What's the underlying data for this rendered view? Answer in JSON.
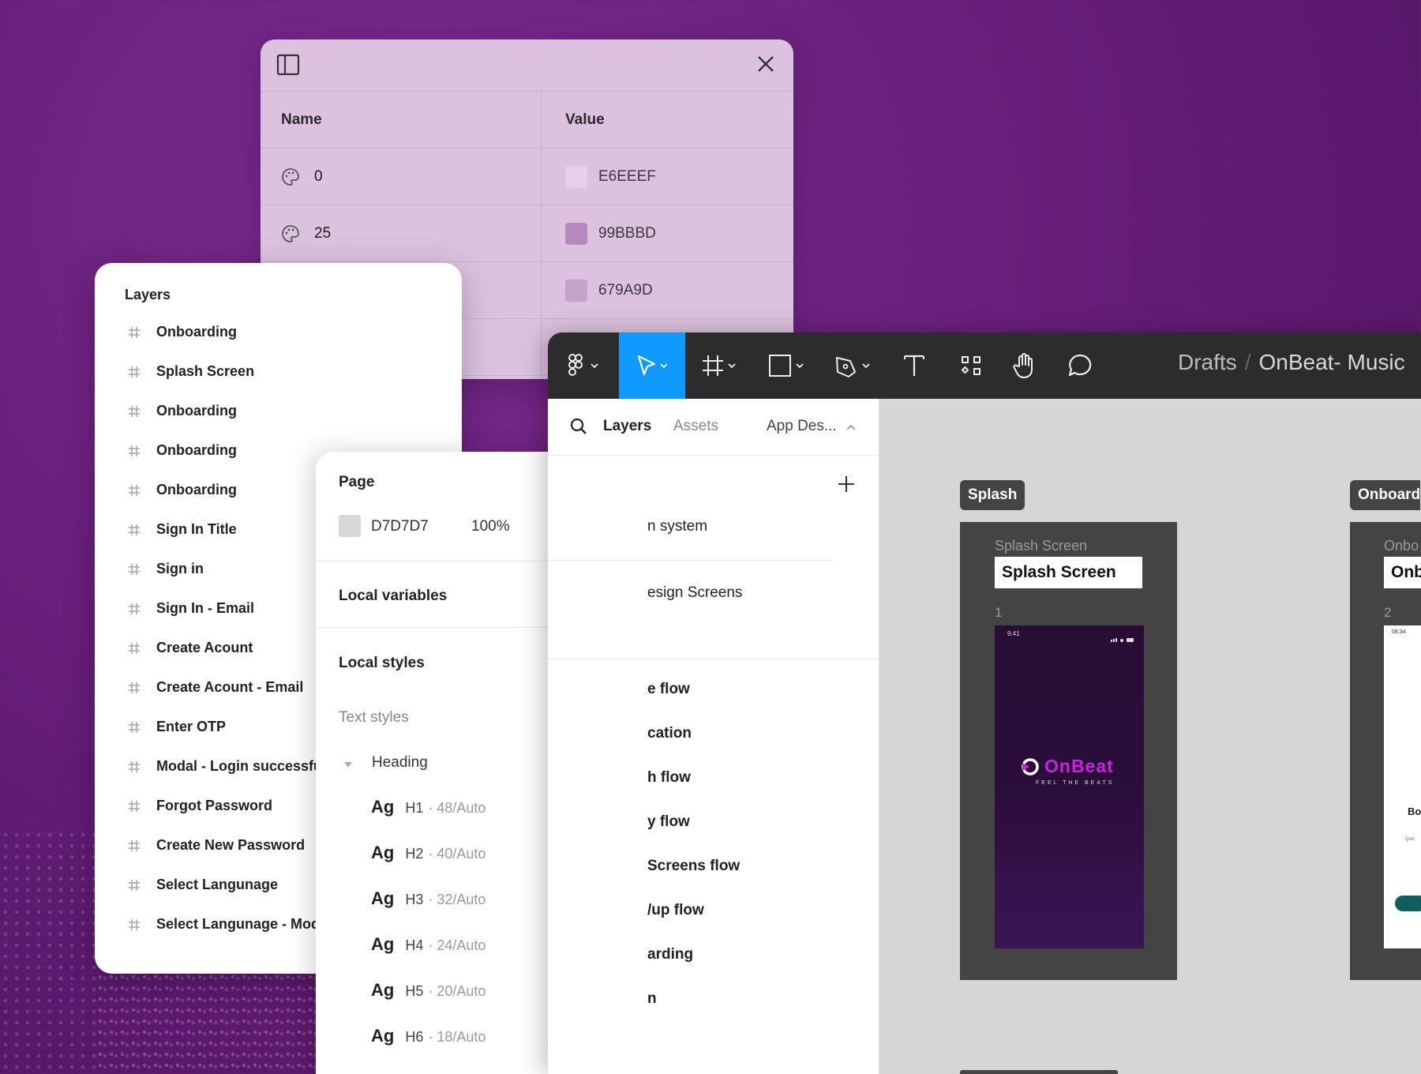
{
  "colors": {
    "accent": "#0d99ff",
    "brand": "#cc22e0",
    "background": "#6a1f7c"
  },
  "variables": {
    "header_name": "Name",
    "header_value": "Value",
    "rows": [
      {
        "name": "0",
        "value": "E6EEEF",
        "color": "#e6cfe8"
      },
      {
        "name": "25",
        "value": "99BBBD",
        "color": "#b889c0"
      },
      {
        "name": "",
        "value": "679A9D",
        "color": "#c4a2c9"
      }
    ]
  },
  "layers_panel": {
    "title": "Layers",
    "items": [
      "Onboarding",
      "Splash Screen",
      "Onboarding",
      "Onboarding",
      "Onboarding",
      "Sign In Title",
      "Sign in",
      "Sign In  - Email",
      "Create Acount",
      "Create Acount - Email",
      "Enter OTP",
      "Modal - Login successfu",
      "Forgot Password",
      "Create New Password",
      "Select Langunage",
      "Select Langunage - Mod"
    ]
  },
  "page_panel": {
    "page_label": "Page",
    "page_color": "D7D7D7",
    "page_opacity": "100%",
    "local_variables": "Local variables",
    "local_styles": "Local styles",
    "text_styles": "Text styles",
    "heading_group": "Heading",
    "ag": "Ag",
    "styles": [
      {
        "name": "H1",
        "meta": "· 48/Auto"
      },
      {
        "name": "H2",
        "meta": "· 40/Auto"
      },
      {
        "name": "H3",
        "meta": "· 32/Auto"
      },
      {
        "name": "H4",
        "meta": "· 24/Auto"
      },
      {
        "name": "H5",
        "meta": "· 20/Auto"
      },
      {
        "name": "H6",
        "meta": "· 18/Auto"
      }
    ]
  },
  "toolbar": {
    "breadcrumb_root": "Drafts",
    "breadcrumb_sep": "/",
    "file_name": "OnBeat- Music"
  },
  "left_pane": {
    "tab_layers": "Layers",
    "tab_assets": "Assets",
    "page_selector": "App Des...",
    "pages": [
      "n system",
      "esign Screens",
      "e flow",
      "cation",
      "h flow",
      "y flow",
      "Screens flow",
      "/up flow",
      "arding",
      "n"
    ]
  },
  "canvas": {
    "frame1_label": "Splash",
    "frame1_name": "Splash Screen",
    "frame1_input": "Splash Screen",
    "frame1_num": "1",
    "frame2_label": "Onboard",
    "frame2_name": "Onbo",
    "frame2_input": "Onb",
    "frame2_num": "2",
    "phone_time": "9:41",
    "phone2_time": "08:34",
    "logo_text": "OnBeat",
    "logo_tagline": "FEEL THE BEATS",
    "phone2_text": "Bo",
    "phone2_small": "Quic"
  }
}
